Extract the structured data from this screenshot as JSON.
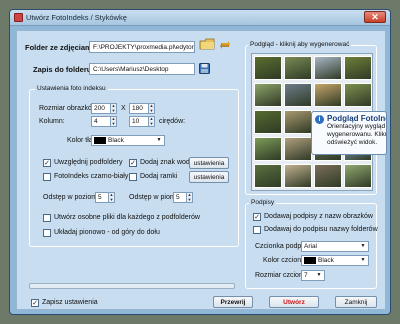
{
  "window": {
    "title": "Utwórz FotoIndeks / Stykówkę",
    "close_label": "✕"
  },
  "source": {
    "label": "Folder ze zdjęciami:",
    "value": "F:\\PROJEKTY\\proxmedia.pl\\edytor_zdjec\\"
  },
  "target": {
    "label": "Zapis do folderu:",
    "value": "C:\\Users\\Mariusz\\Desktop"
  },
  "settings": {
    "group_title": "Ustawienia foto indeksu",
    "size_label": "Rozmiar obrazków:",
    "width": "200",
    "x_sep": "X",
    "height": "180",
    "columns_label": "Kolumn:",
    "columns": "4",
    "gap": "10",
    "gap_label": "cirędów:",
    "bg_label": "Kolor tła:",
    "bg_value": "Black",
    "subfolders_label": "Uwzględnij podfoldery",
    "watermark_label": "Dodaj znak wodny",
    "watermark_button": "ustawienia",
    "bw_label": "FotoIndeks czarno-biały",
    "frame_label": "Dodaj ramki",
    "frame_button": "ustawienia",
    "hgap_label": "Odstęp w poziomie:",
    "hgap": "5",
    "vgap_label": "Odstęp w pionie:",
    "vgap": "5",
    "separate_label": "Utwórz osobne pliki dla każdego z podfolderów",
    "vertical_label": "Układaj pionowo - od góry do dołu"
  },
  "preview": {
    "title": "Podgląd - kliknij aby wygenerować",
    "thumbs": [
      "#5b6e2f",
      "#7a8c55",
      "#a8b6c4",
      "#6f7f3a",
      "#8ea36b",
      "#6e7c8a",
      "#c4a56b",
      "#7d8f4f",
      "#556b2f",
      "#a89a70",
      "#9caf8a",
      "#4f6b3a",
      "#7f9b5a",
      "#b0a080",
      "#6a7a5a",
      "#8fb0c8",
      "#5a7040",
      "#c0b090",
      "#7a6f5a",
      "#90a870"
    ]
  },
  "tooltip": {
    "title": "Podgląd FotoIndeks",
    "line1": "Orientacyjny wygląd Fo",
    "line2": "wygenerowanu. Kliknij",
    "line3": "odświeżyć widok."
  },
  "captions": {
    "group_title": "Podpisy",
    "add_names_label": "Dodawaj podpisy z nazw obrazków",
    "add_folders_label": "Dodawaj do podpisu nazwy folderów",
    "font_label": "Czcionka podpisów:",
    "font_value": "Arial",
    "color_label": "Kolor czcionki:",
    "color_value": "Black",
    "size_label": "Rozmiar czcionki:",
    "size_value": "7"
  },
  "footer": {
    "save_settings_label": "Zapisz ustawienia",
    "reset_button": "Przewrij",
    "create_button": "Utwórz",
    "close_button": "Zamknij"
  },
  "colors": {
    "accent_red": "#cc1111",
    "window_blue": "#8fb8d8",
    "panel": "#c8ddef"
  }
}
